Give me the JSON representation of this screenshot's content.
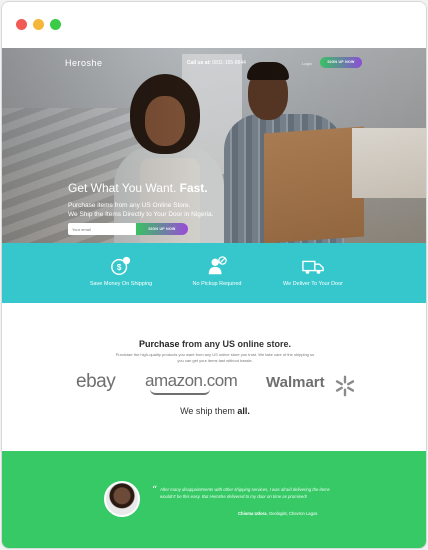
{
  "window": {
    "controls": [
      "close",
      "minimize",
      "maximize"
    ]
  },
  "nav": {
    "logo": "Heroshe",
    "call_label": "Call us at:",
    "call_number": "0811-155-8844",
    "login_label": "Login",
    "signup_label": "SIGN UP NOW"
  },
  "hero": {
    "headline_main": "Get What You Want.",
    "headline_bold": "Fast.",
    "sub_line1": "Purchase items from any US Online Store.",
    "sub_line2": "We Ship the Items Directly to Your Door in Nigeria.",
    "email_placeholder": "Your email",
    "signup_label": "SIGN UP NOW"
  },
  "features": [
    {
      "icon": "money-icon",
      "label": "Save Money On Shipping"
    },
    {
      "icon": "no-pickup-icon",
      "label": "No Pickup Required"
    },
    {
      "icon": "delivery-truck-icon",
      "label": "We Deliver To Your Door"
    }
  ],
  "stores": {
    "title_bold": "Purchase",
    "title_rest": " from any US online store.",
    "description": "Purchase the high-quality products you want from any US online store you trust. We take care of the shipping so you can get your items fast without hassle.",
    "brands": [
      "ebay",
      "amazon.com",
      "Walmart"
    ],
    "ship_prefix": "We ship them ",
    "ship_bold": "all."
  },
  "testimonial": {
    "quote": "After many disappointments with other shipping services, I was afraid delivering the items wouldn't be this easy. But Heroshe delivered to my door on time as promised!",
    "author_name": "Chioma Udora",
    "author_detail": ", Geologist, Chevron Lagos"
  },
  "colors": {
    "feature_band": "#36c7cc",
    "testimonial_band": "#36c966",
    "cta_gradient_start": "#39c163",
    "cta_gradient_end": "#9a4bd8"
  }
}
